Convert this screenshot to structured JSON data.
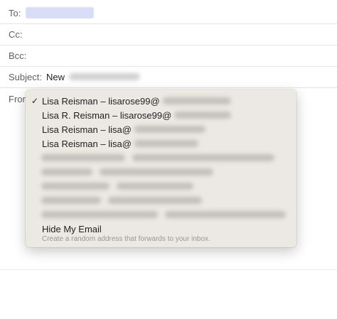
{
  "compose": {
    "to_label": "To:",
    "cc_label": "Cc:",
    "bcc_label": "Bcc:",
    "subject_label": "Subject:",
    "subject_value": "New",
    "from_label": "From"
  },
  "menu": {
    "items": [
      {
        "label": "Lisa Reisman – lisarose99@",
        "selected": true
      },
      {
        "label": "Lisa R. Reisman – lisarose99@",
        "selected": false
      },
      {
        "label": "Lisa Reisman – lisa@",
        "selected": false
      },
      {
        "label": "Lisa Reisman – lisa@",
        "selected": false
      }
    ],
    "hide_my_email": {
      "title": "Hide My Email",
      "subtitle": "Create a random address that forwards to your inbox."
    }
  },
  "icons": {
    "check": "checkmark-icon"
  }
}
